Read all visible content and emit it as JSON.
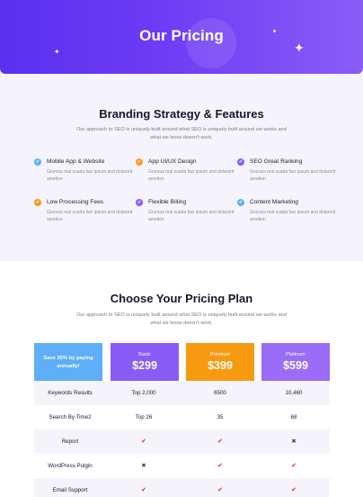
{
  "hero": {
    "title": "Our Pricing"
  },
  "features_section": {
    "title": "Branding Strategy & Features",
    "subtitle": "Our approach to SEO is uniquely built around what SEO is uniquely built around we works and what we know doesn't work.",
    "items": [
      {
        "title": "Mobile App & Website",
        "description": "Grursus mal suada faci ipsum and dolarorit ametion",
        "icon": "check-circle-icon",
        "color": "#5eaff7"
      },
      {
        "title": "App UI/UX Design",
        "description": "Grursus mal suada faci ipsum and dolarorit ametion",
        "icon": "check-circle-icon",
        "color": "#f59a23"
      },
      {
        "title": "SEO Great Ranking",
        "description": "Grursus mal suada faci ipsum and dolarorit ametion",
        "icon": "check-circle-icon",
        "color": "#8a5cf7"
      },
      {
        "title": "Low Processing Fees",
        "description": "Grursus mal suada faci ipsum and dolarorit ametion",
        "icon": "check-circle-icon",
        "color": "#f59a23"
      },
      {
        "title": "Flexible Billing",
        "description": "Grursus mal suada faci ipsum and dolarorit ametion",
        "icon": "check-circle-icon",
        "color": "#8a5cf7"
      },
      {
        "title": "Content Marketing",
        "description": "Grursus mal suada faci ipsum and dolarorit ametion",
        "icon": "check-circle-icon",
        "color": "#5eaff7"
      }
    ]
  },
  "pricing_section": {
    "title": "Choose Your Pricing Plan",
    "subtitle": "Our approach to SEO is uniquely built around what SEO is uniquely built around we works and what we know doesn't work.",
    "save_badge": "Save 35% by paying annually!",
    "plans": [
      {
        "name": "Basic",
        "price": "$299",
        "color": "#8a5cf7"
      },
      {
        "name": "Premium",
        "price": "$399",
        "color": "#f79a10"
      },
      {
        "name": "Platinum",
        "price": "$599",
        "color": "#9a6cf8"
      }
    ],
    "rows": [
      {
        "label": "Keywords Results",
        "values": [
          "Top 2,000",
          "6500",
          "10,460"
        ]
      },
      {
        "label": "Search By Time2",
        "values": [
          "Top 26",
          "35",
          "68"
        ]
      },
      {
        "label": "Report",
        "values": [
          "✔",
          "✔",
          "✖"
        ]
      },
      {
        "label": "WordPress Pulgin",
        "values": [
          "✖",
          "✔",
          "✔"
        ]
      },
      {
        "label": "Email Support",
        "values": [
          "✔",
          "✔",
          "✔"
        ]
      }
    ],
    "check_color": "#e8174f"
  }
}
